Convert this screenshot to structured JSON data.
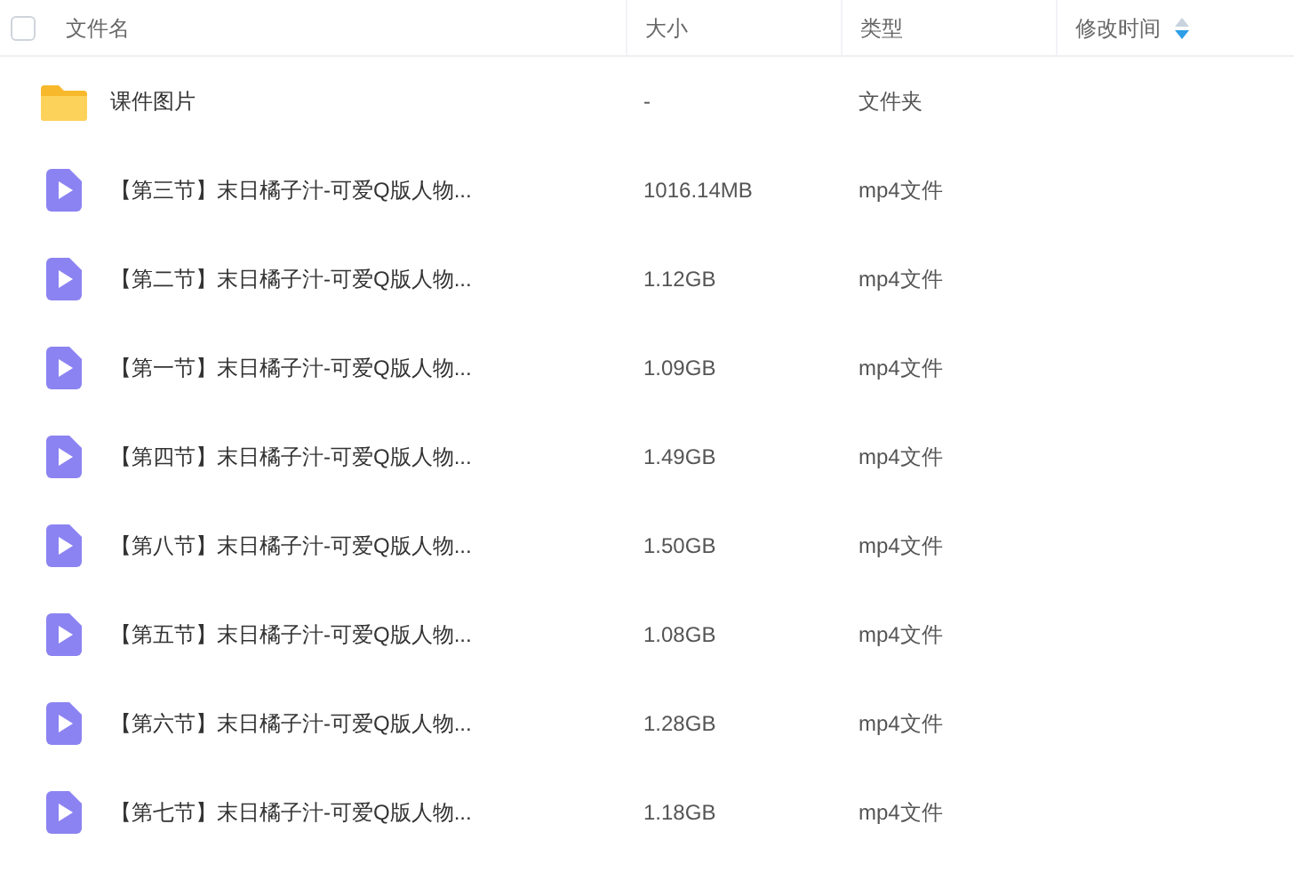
{
  "header": {
    "checked": false,
    "columns": [
      {
        "label": "文件名",
        "sorted": false
      },
      {
        "label": "大小",
        "sorted": false
      },
      {
        "label": "类型",
        "sorted": false
      },
      {
        "label": "修改时间",
        "sorted": true
      }
    ]
  },
  "rows": [
    {
      "kind": "folder",
      "name": "课件图片",
      "size": "-",
      "type": "文件夹"
    },
    {
      "kind": "video",
      "name": "【第三节】末日橘子汁-可爱Q版人物...",
      "size": "1016.14MB",
      "type": "mp4文件"
    },
    {
      "kind": "video",
      "name": "【第二节】末日橘子汁-可爱Q版人物...",
      "size": "1.12GB",
      "type": "mp4文件"
    },
    {
      "kind": "video",
      "name": "【第一节】末日橘子汁-可爱Q版人物...",
      "size": "1.09GB",
      "type": "mp4文件"
    },
    {
      "kind": "video",
      "name": "【第四节】末日橘子汁-可爱Q版人物...",
      "size": "1.49GB",
      "type": "mp4文件"
    },
    {
      "kind": "video",
      "name": "【第八节】末日橘子汁-可爱Q版人物...",
      "size": "1.50GB",
      "type": "mp4文件"
    },
    {
      "kind": "video",
      "name": "【第五节】末日橘子汁-可爱Q版人物...",
      "size": "1.08GB",
      "type": "mp4文件"
    },
    {
      "kind": "video",
      "name": "【第六节】末日橘子汁-可爱Q版人物...",
      "size": "1.28GB",
      "type": "mp4文件"
    },
    {
      "kind": "video",
      "name": "【第七节】末日橘子汁-可爱Q版人物...",
      "size": "1.18GB",
      "type": "mp4文件"
    }
  ]
}
